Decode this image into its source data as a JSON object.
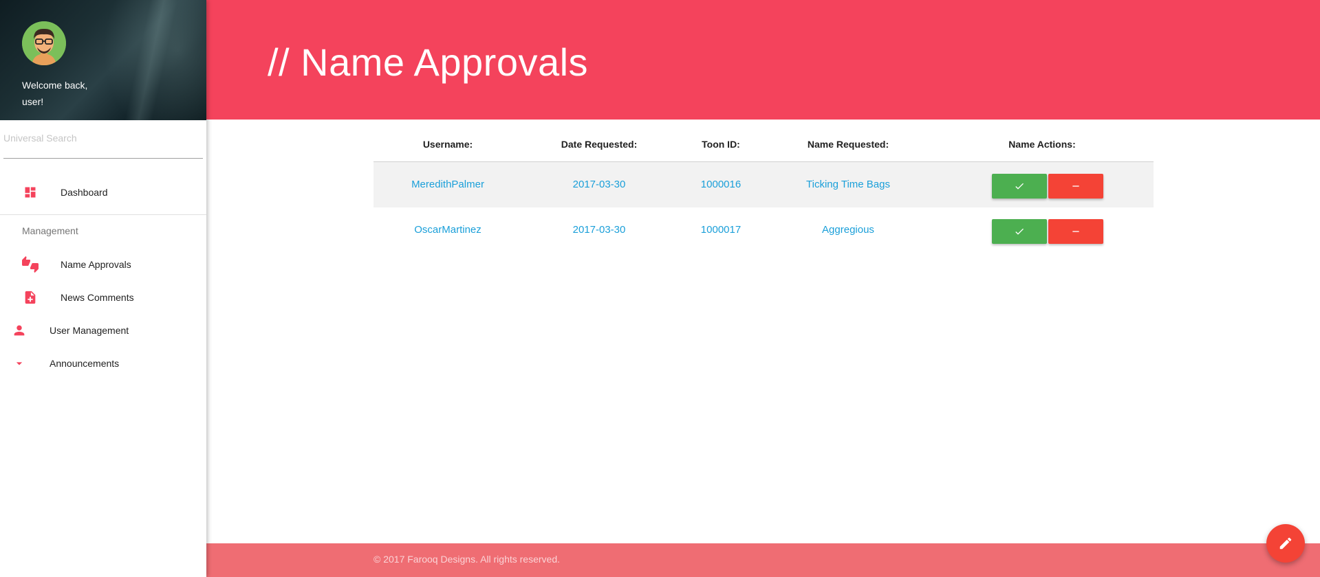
{
  "colors": {
    "primary": "#f4435c",
    "approve": "#4caf50",
    "deny": "#f44336",
    "link": "#1a9fd9",
    "footer": "#ef6d73"
  },
  "sidebar": {
    "welcome_line1": "Welcome back,",
    "welcome_line2": "user!",
    "search_placeholder": "Universal Search",
    "dashboard_label": "Dashboard",
    "section_label": "Management",
    "items": [
      {
        "label": "Name Approvals",
        "icon": "thumbs-up-down-icon"
      },
      {
        "label": "News Comments",
        "icon": "note-add-icon"
      },
      {
        "label": "User Management",
        "icon": "person-icon"
      },
      {
        "label": "Announcements",
        "icon": "arrow-drop-down-icon"
      }
    ]
  },
  "header": {
    "title": "// Name Approvals"
  },
  "table": {
    "columns": [
      "Username:",
      "Date Requested:",
      "Toon ID:",
      "Name Requested:",
      "Name Actions:"
    ],
    "rows": [
      {
        "username": "MeredithPalmer",
        "date": "2017-03-30",
        "toon_id": "1000016",
        "name": "Ticking Time Bags"
      },
      {
        "username": "OscarMartinez",
        "date": "2017-03-30",
        "toon_id": "1000017",
        "name": "Aggregious"
      }
    ]
  },
  "footer": {
    "copyright": "© 2017 Farooq Designs. All rights reserved."
  }
}
